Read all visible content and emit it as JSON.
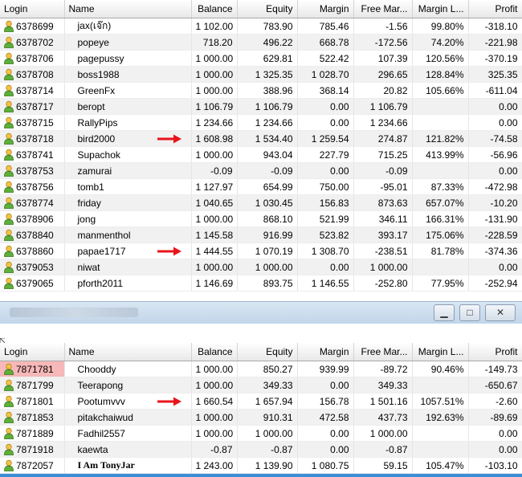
{
  "columns": [
    "Login",
    "Name",
    "Balance",
    "Equity",
    "Margin",
    "Free Mar...",
    "Margin L...",
    "Profit"
  ],
  "top_rows": [
    {
      "login": "6378699",
      "name": "jax(เจ๊ก)",
      "balance": "1 102.00",
      "equity": "783.90",
      "margin": "785.46",
      "free_margin": "-1.56",
      "margin_level": "99.80%",
      "profit": "-318.10"
    },
    {
      "login": "6378702",
      "name": "popeye",
      "balance": "718.20",
      "equity": "496.22",
      "margin": "668.78",
      "free_margin": "-172.56",
      "margin_level": "74.20%",
      "profit": "-221.98"
    },
    {
      "login": "6378706",
      "name": "pagepussy",
      "balance": "1 000.00",
      "equity": "629.81",
      "margin": "522.42",
      "free_margin": "107.39",
      "margin_level": "120.56%",
      "profit": "-370.19"
    },
    {
      "login": "6378708",
      "name": "boss1988",
      "balance": "1 000.00",
      "equity": "1 325.35",
      "margin": "1 028.70",
      "free_margin": "296.65",
      "margin_level": "128.84%",
      "profit": "325.35"
    },
    {
      "login": "6378714",
      "name": "GreenFx",
      "balance": "1 000.00",
      "equity": "388.96",
      "margin": "368.14",
      "free_margin": "20.82",
      "margin_level": "105.66%",
      "profit": "-611.04"
    },
    {
      "login": "6378717",
      "name": "beropt",
      "balance": "1 106.79",
      "equity": "1 106.79",
      "margin": "0.00",
      "free_margin": "1 106.79",
      "margin_level": "",
      "profit": "0.00"
    },
    {
      "login": "6378715",
      "name": "RallyPips",
      "balance": "1 234.66",
      "equity": "1 234.66",
      "margin": "0.00",
      "free_margin": "1 234.66",
      "margin_level": "",
      "profit": "0.00"
    },
    {
      "login": "6378718",
      "name": "bird2000",
      "balance": "1 608.98",
      "equity": "1 534.40",
      "margin": "1 259.54",
      "free_margin": "274.87",
      "margin_level": "121.82%",
      "profit": "-74.58",
      "arrow": true
    },
    {
      "login": "6378741",
      "name": "Supachok",
      "balance": "1 000.00",
      "equity": "943.04",
      "margin": "227.79",
      "free_margin": "715.25",
      "margin_level": "413.99%",
      "profit": "-56.96"
    },
    {
      "login": "6378753",
      "name": "zamurai",
      "balance": "-0.09",
      "equity": "-0.09",
      "margin": "0.00",
      "free_margin": "-0.09",
      "margin_level": "",
      "profit": "0.00"
    },
    {
      "login": "6378756",
      "name": "tomb1",
      "balance": "1 127.97",
      "equity": "654.99",
      "margin": "750.00",
      "free_margin": "-95.01",
      "margin_level": "87.33%",
      "profit": "-472.98"
    },
    {
      "login": "6378774",
      "name": "friday",
      "balance": "1 040.65",
      "equity": "1 030.45",
      "margin": "156.83",
      "free_margin": "873.63",
      "margin_level": "657.07%",
      "profit": "-10.20"
    },
    {
      "login": "6378906",
      "name": "jong",
      "balance": "1 000.00",
      "equity": "868.10",
      "margin": "521.99",
      "free_margin": "346.11",
      "margin_level": "166.31%",
      "profit": "-131.90"
    },
    {
      "login": "6378840",
      "name": "manmenthol",
      "balance": "1 145.58",
      "equity": "916.99",
      "margin": "523.82",
      "free_margin": "393.17",
      "margin_level": "175.06%",
      "profit": "-228.59"
    },
    {
      "login": "6378860",
      "name": "papae1717",
      "balance": "1 444.55",
      "equity": "1 070.19",
      "margin": "1 308.70",
      "free_margin": "-238.51",
      "margin_level": "81.78%",
      "profit": "-374.36",
      "arrow": true
    },
    {
      "login": "6379053",
      "name": "niwat",
      "balance": "1 000.00",
      "equity": "1 000.00",
      "margin": "0.00",
      "free_margin": "1 000.00",
      "margin_level": "",
      "profit": "0.00"
    },
    {
      "login": "6379065",
      "name": "pforth2011",
      "balance": "1 146.69",
      "equity": "893.75",
      "margin": "1 146.55",
      "free_margin": "-252.80",
      "margin_level": "77.95%",
      "profit": "-252.94"
    }
  ],
  "bottom_rows": [
    {
      "login": "7871781",
      "name": "Chooddy",
      "balance": "1 000.00",
      "equity": "850.27",
      "margin": "939.99",
      "free_margin": "-89.72",
      "margin_level": "90.46%",
      "profit": "-149.73",
      "selected": true
    },
    {
      "login": "7871799",
      "name": "Teerapong",
      "balance": "1 000.00",
      "equity": "349.33",
      "margin": "0.00",
      "free_margin": "349.33",
      "margin_level": "",
      "profit": "-650.67"
    },
    {
      "login": "7871801",
      "name": "Pootumvvv",
      "balance": "1 660.54",
      "equity": "1 657.94",
      "margin": "156.78",
      "free_margin": "1 501.16",
      "margin_level": "1057.51%",
      "profit": "-2.60",
      "arrow": true
    },
    {
      "login": "7871853",
      "name": "pitakchaiwud",
      "balance": "1 000.00",
      "equity": "910.31",
      "margin": "472.58",
      "free_margin": "437.73",
      "margin_level": "192.63%",
      "profit": "-89.69"
    },
    {
      "login": "7871889",
      "name": "Fadhil2557",
      "balance": "1 000.00",
      "equity": "1 000.00",
      "margin": "0.00",
      "free_margin": "1 000.00",
      "margin_level": "",
      "profit": "0.00"
    },
    {
      "login": "7871918",
      "name": "kaewta",
      "balance": "-0.87",
      "equity": "-0.87",
      "margin": "0.00",
      "free_margin": "-0.87",
      "margin_level": "",
      "profit": "0.00"
    },
    {
      "login": "7872057",
      "name": "I Am TonyJar",
      "balance": "1 243.00",
      "equity": "1 139.90",
      "margin": "1 080.75",
      "free_margin": "59.15",
      "margin_level": "105.47%",
      "profit": "-103.10",
      "serif": true
    }
  ],
  "window_buttons": {
    "minimize": "▁",
    "maximize": "□",
    "close": "✕"
  },
  "colors": {
    "arrow": "#e8141b",
    "selected": "#f6b8b8",
    "title_bar": "#c9d9ea",
    "bottom_accent": "#3c8fd6"
  }
}
